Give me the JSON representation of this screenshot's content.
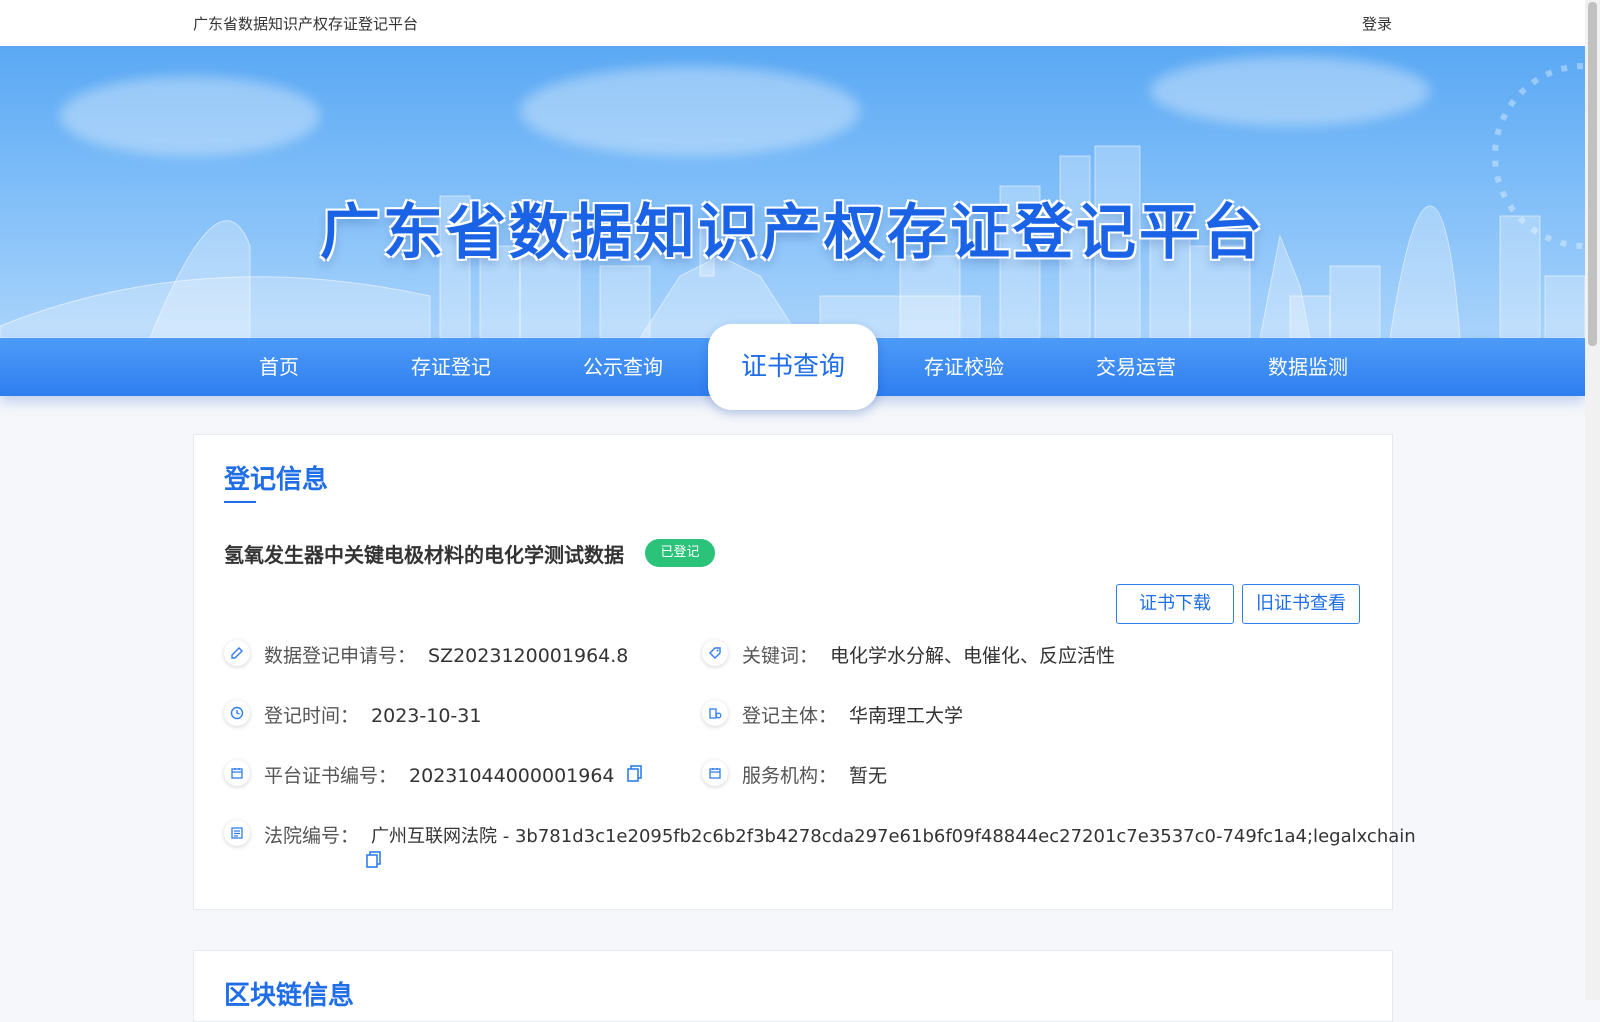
{
  "header": {
    "site_name": "广东省数据知识产权存证登记平台",
    "login": "登录"
  },
  "banner": {
    "title": "广东省数据知识产权存证登记平台"
  },
  "nav": {
    "items": [
      "首页",
      "存证登记",
      "公示查询",
      "证书查询",
      "存证校验",
      "交易运营",
      "数据监测"
    ],
    "active_index": 3
  },
  "registration": {
    "section_title": "登记信息",
    "data_title": "氢氧发生器中关键电极材料的电化学测试数据",
    "status": "已登记",
    "buttons": {
      "download": "证书下载",
      "old_view": "旧证书查看"
    },
    "fields": {
      "application_no": {
        "label": "数据登记申请号：",
        "value": "SZ2023120001964.8"
      },
      "keywords": {
        "label": "关键词：",
        "value": "电化学水分解、电催化、反应活性"
      },
      "reg_time": {
        "label": "登记时间：",
        "value": "2023-10-31"
      },
      "subject": {
        "label": "登记主体：",
        "value": "华南理工大学"
      },
      "cert_no": {
        "label": "平台证书编号：",
        "value": "20231044000001964"
      },
      "service_org": {
        "label": "服务机构：",
        "value": "暂无"
      },
      "court_no": {
        "label": "法院编号：",
        "value": "广州互联网法院 - 3b781d3c1e2095fb2c6b2f3b4278cda297e61b6f09f48844ec27201c7e3537c0-749fc1a4;legalxchain"
      }
    }
  },
  "blockchain": {
    "section_title": "区块链信息"
  },
  "colors": {
    "primary": "#1f6ee8",
    "nav": "#2f7ef0",
    "success": "#2bc27a"
  },
  "icons": [
    "edit-icon",
    "tag-icon",
    "clock-icon",
    "org-icon",
    "calendar-icon",
    "calendar-icon",
    "list-icon",
    "copy-icon"
  ]
}
